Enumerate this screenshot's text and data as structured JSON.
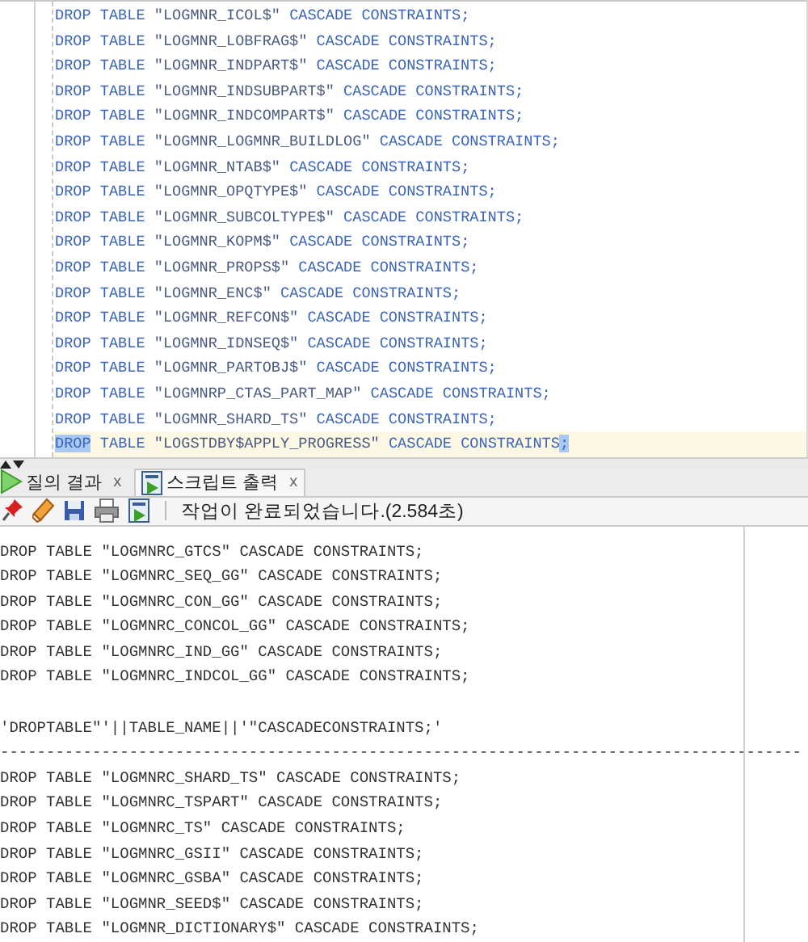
{
  "editor": {
    "lines": [
      {
        "current": false,
        "parts": [
          {
            "text": "DROP TABLE \"LOGMNR_ICOL$\" CASCADE CONSTRAINTS;",
            "highlighted": false
          }
        ]
      },
      {
        "current": false,
        "parts": [
          {
            "text": "DROP TABLE \"LOGMNR_LOBFRAG$\" CASCADE CONSTRAINTS;",
            "highlighted": false
          }
        ]
      },
      {
        "current": false,
        "parts": [
          {
            "text": "DROP TABLE \"LOGMNR_INDPART$\" CASCADE CONSTRAINTS;",
            "highlighted": false
          }
        ]
      },
      {
        "current": false,
        "parts": [
          {
            "text": "DROP TABLE \"LOGMNR_INDSUBPART$\" CASCADE CONSTRAINTS;",
            "highlighted": false
          }
        ]
      },
      {
        "current": false,
        "parts": [
          {
            "text": "DROP TABLE \"LOGMNR_INDCOMPART$\" CASCADE CONSTRAINTS;",
            "highlighted": false
          }
        ]
      },
      {
        "current": false,
        "parts": [
          {
            "text": "DROP TABLE \"LOGMNR_LOGMNR_BUILDLOG\" CASCADE CONSTRAINTS;",
            "highlighted": false
          }
        ]
      },
      {
        "current": false,
        "parts": [
          {
            "text": "DROP TABLE \"LOGMNR_NTAB$\" CASCADE CONSTRAINTS;",
            "highlighted": false
          }
        ]
      },
      {
        "current": false,
        "parts": [
          {
            "text": "DROP TABLE \"LOGMNR_OPQTYPE$\" CASCADE CONSTRAINTS;",
            "highlighted": false
          }
        ]
      },
      {
        "current": false,
        "parts": [
          {
            "text": "DROP TABLE \"LOGMNR_SUBCOLTYPE$\" CASCADE CONSTRAINTS;",
            "highlighted": false
          }
        ]
      },
      {
        "current": false,
        "parts": [
          {
            "text": "DROP TABLE \"LOGMNR_KOPM$\" CASCADE CONSTRAINTS;",
            "highlighted": false
          }
        ]
      },
      {
        "current": false,
        "parts": [
          {
            "text": "DROP TABLE \"LOGMNR_PROPS$\" CASCADE CONSTRAINTS;",
            "highlighted": false
          }
        ]
      },
      {
        "current": false,
        "parts": [
          {
            "text": "DROP TABLE \"LOGMNR_ENC$\" CASCADE CONSTRAINTS;",
            "highlighted": false
          }
        ]
      },
      {
        "current": false,
        "parts": [
          {
            "text": "DROP TABLE \"LOGMNR_REFCON$\" CASCADE CONSTRAINTS;",
            "highlighted": false
          }
        ]
      },
      {
        "current": false,
        "parts": [
          {
            "text": "DROP TABLE \"LOGMNR_IDNSEQ$\" CASCADE CONSTRAINTS;",
            "highlighted": false
          }
        ]
      },
      {
        "current": false,
        "parts": [
          {
            "text": "DROP TABLE \"LOGMNR_PARTOBJ$\" CASCADE CONSTRAINTS;",
            "highlighted": false
          }
        ]
      },
      {
        "current": false,
        "parts": [
          {
            "text": "DROP TABLE \"LOGMNRP_CTAS_PART_MAP\" CASCADE CONSTRAINTS;",
            "highlighted": false
          }
        ]
      },
      {
        "current": false,
        "parts": [
          {
            "text": "DROP TABLE \"LOGMNR_SHARD_TS\" CASCADE CONSTRAINTS;",
            "highlighted": false
          }
        ]
      },
      {
        "current": true,
        "parts": [
          {
            "text": "DROP",
            "highlighted": true
          },
          {
            "text": " TABLE \"LOGSTDBY$APPLY_PROGRESS\" CASCADE CONSTRAINTS",
            "highlighted": false
          },
          {
            "text": ";",
            "highlighted": true
          }
        ]
      }
    ]
  },
  "tabs": [
    {
      "label": "질의 결과",
      "close": "x",
      "kind": "query",
      "selected": false
    },
    {
      "label": "스크립트 출력",
      "close": "x",
      "kind": "script",
      "selected": true
    }
  ],
  "output": {
    "message": "작업이 완료되었습니다.(2.584초)",
    "lines_before": [
      "DROP TABLE \"LOGMNRC_GTCS\" CASCADE CONSTRAINTS;",
      "DROP TABLE \"LOGMNRC_SEQ_GG\" CASCADE CONSTRAINTS;",
      "DROP TABLE \"LOGMNRC_CON_GG\" CASCADE CONSTRAINTS;",
      "DROP TABLE \"LOGMNRC_CONCOL_GG\" CASCADE CONSTRAINTS;",
      "DROP TABLE \"LOGMNRC_IND_GG\" CASCADE CONSTRAINTS;",
      "DROP TABLE \"LOGMNRC_INDCOL_GG\" CASCADE CONSTRAINTS;"
    ],
    "column_header": "'DROPTABLE\"'||TABLE_NAME||'\"CASCADECONSTRAINTS;'",
    "separator": "---------------------------------------------------------------------------------------",
    "lines_after": [
      "DROP TABLE \"LOGMNRC_SHARD_TS\" CASCADE CONSTRAINTS;",
      "DROP TABLE \"LOGMNRC_TSPART\" CASCADE CONSTRAINTS;",
      "DROP TABLE \"LOGMNRC_TS\" CASCADE CONSTRAINTS;",
      "DROP TABLE \"LOGMNRC_GSII\" CASCADE CONSTRAINTS;",
      "DROP TABLE \"LOGMNRC_GSBA\" CASCADE CONSTRAINTS;",
      "DROP TABLE \"LOGMNR_SEED$\" CASCADE CONSTRAINTS;",
      "DROP TABLE \"LOGMNR_DICTIONARY$\" CASCADE CONSTRAINTS;"
    ]
  }
}
